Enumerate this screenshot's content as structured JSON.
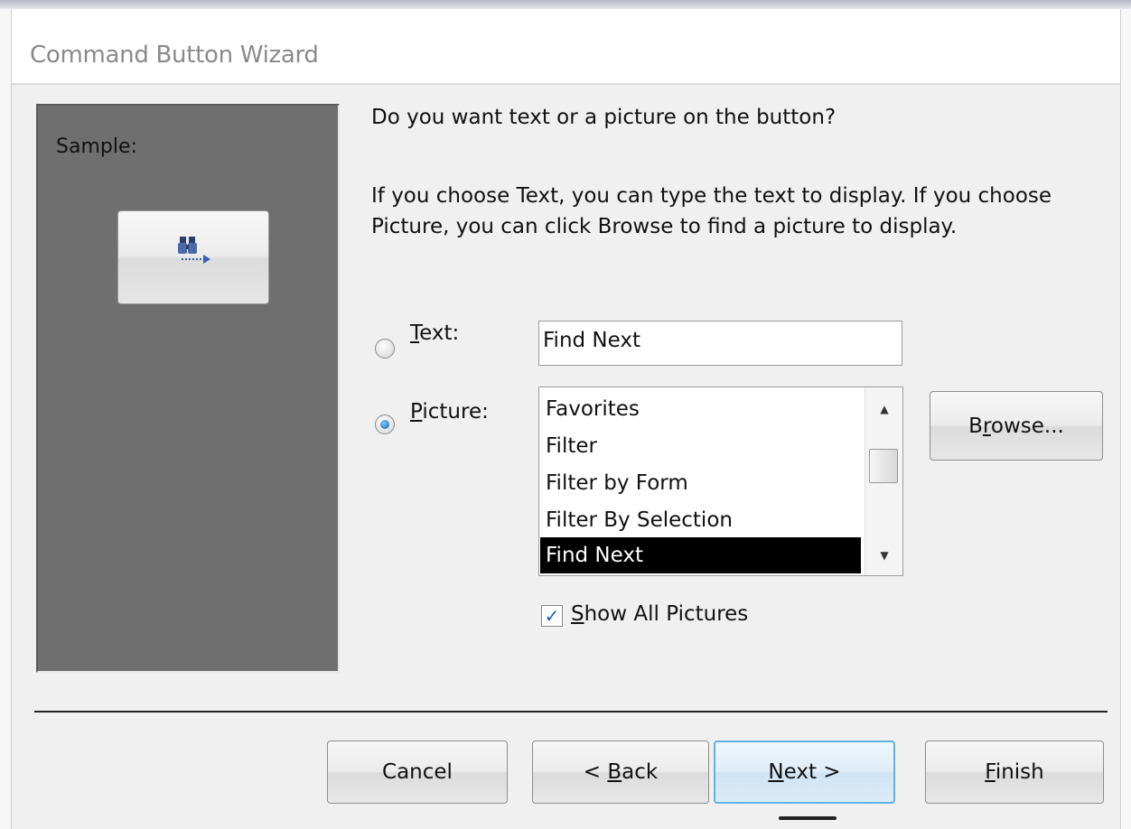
{
  "window": {
    "title": "Command Button Wizard"
  },
  "sample": {
    "label": "Sample:",
    "button_icon": "binoculars-find-next-icon"
  },
  "question": "Do you want text or a picture on the button?",
  "instructions": "If you choose Text, you can type the text to display.  If you choose Picture, you can click Browse to find a picture to display.",
  "options": {
    "text": {
      "label_ul": "T",
      "label_rest": "ext:",
      "selected": false,
      "value": "Find Next"
    },
    "picture": {
      "label_ul": "P",
      "label_rest": "icture:",
      "selected": true
    }
  },
  "picture_list": {
    "items": [
      "Favorites",
      "Filter",
      "Filter by Form",
      "Filter By Selection",
      "Find Next"
    ],
    "selected": "Find Next"
  },
  "show_all": {
    "label_ul": "S",
    "label_rest": "how All Pictures",
    "checked": true
  },
  "buttons": {
    "browse": {
      "pre": "B",
      "ul": "r",
      "post": "owse..."
    },
    "cancel": {
      "pre": "",
      "ul": "",
      "post": "Cancel"
    },
    "back": {
      "pre": "< ",
      "ul": "B",
      "post": "ack"
    },
    "next": {
      "pre": "",
      "ul": "N",
      "post": "ext >"
    },
    "finish": {
      "pre": "",
      "ul": "F",
      "post": "inish"
    }
  },
  "colors": {
    "sample_panel": "#6f6f6f",
    "selection": "#000000",
    "default_button_border": "#5fb3e4"
  }
}
